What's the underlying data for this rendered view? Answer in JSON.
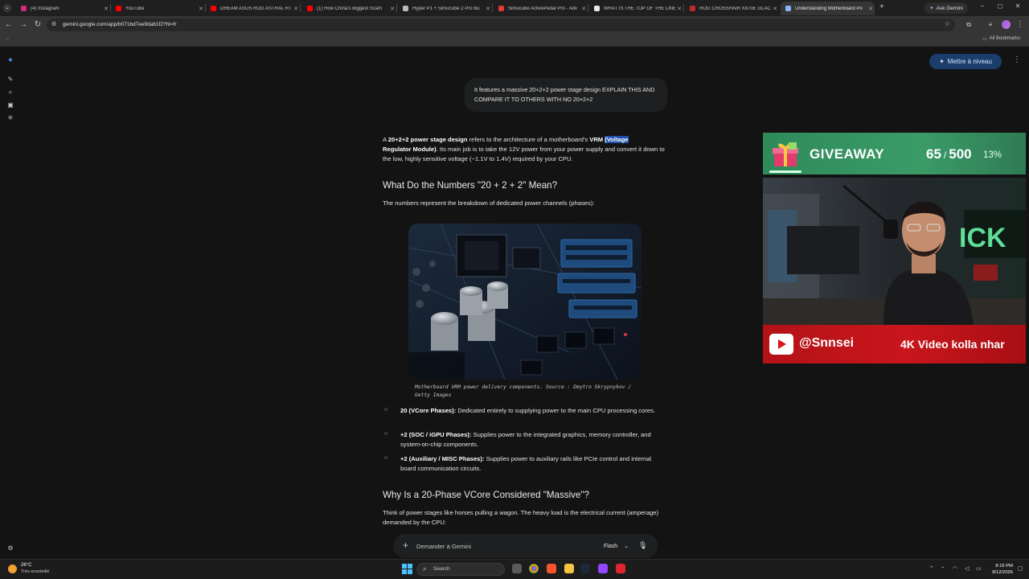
{
  "browser": {
    "tabs": [
      {
        "title": "(4) Instagram",
        "color": "#d62976"
      },
      {
        "title": "YouTube",
        "color": "#ff0000"
      },
      {
        "title": "DREAM ASUS ROG ASTRAL RTX",
        "color": "#ff0000"
      },
      {
        "title": "(1) How China's Biggest Scam",
        "color": "#ff0000"
      },
      {
        "title": "Hyper P1 + Simucube 2 Pro Bu",
        "color": "#bdbdbd"
      },
      {
        "title": "Simucube ActivePedal Pro - Adv",
        "color": "#e53935"
      },
      {
        "title": "WHAT IS THE TOP OF THE LINE",
        "color": "#e8eaed"
      },
      {
        "title": "ROG CROSSHAIR X870E GLACI",
        "color": "#c62828"
      },
      {
        "title": "Understanding Motherboard Po",
        "color": "#8ab4f8"
      }
    ],
    "ask_gemini": "Ask Gemini",
    "url": "gemini.google.com/app/b071bd7ee9dab1f2?hl=fr",
    "all_bookmarks": "All Bookmarks"
  },
  "gemini": {
    "upgrade_label": "Mettre à niveau",
    "user_prompt": "It features a massive 20+2+2 power stage design EXPLAIN THIS AND COMPARE IT TO OTHERS WITH NO 20+2+2",
    "intro": {
      "p1": "A ",
      "b1": "20+2+2 power stage design",
      "p2": " refers to the architecture of a motherboard's ",
      "b2": "VRM ",
      "hl": "(Voltage",
      "b3": "Regulator Module)",
      "p3": ". Its main job is to take the 12V power from your power supply and convert it down to the low, highly sensitive voltage (~1.1V to 1.4V) required by your CPU."
    },
    "heading1": "What Do the Numbers \"20 + 2 + 2\" Mean?",
    "numbers_intro": "The numbers represent the breakdown of dedicated power channels (phases):",
    "figure_caption": "Motherboard VRM power delivery components. Source : Dmytro Skrypnykov / Getty Images",
    "list": [
      {
        "bold": "20 (VCore Phases):",
        "text": " Dedicated entirely to supplying power to the main CPU processing cores."
      },
      {
        "bold": "+2 (SOC / iGPU Phases):",
        "text": " Supplies power to the integrated graphics, memory controller, and system-on-chip components."
      },
      {
        "bold": "+2 (Auxiliary / MISC Phases):",
        "text": " Supplies power to auxiliary rails like PCIe control and internal board communication circuits."
      }
    ],
    "heading2": "Why Is a 20-Phase VCore Considered \"Massive\"?",
    "analogy": "Think of power stages like horses pulling a wagon. The heavy load is the electrical current (amperage) demanded by the CPU:",
    "prompt_placeholder": "Demander à Gemini",
    "model_label": "Flash"
  },
  "overlay": {
    "giveaway_title": "GIVEAWAY",
    "count_current": "65",
    "count_total": "500",
    "percent": "13%",
    "progress_fraction": 0.13,
    "channel_handle": "@Snnsei",
    "channel_message": "4K Video kolla nhar"
  },
  "taskbar": {
    "temperature": "26°C",
    "weather_desc": "Très ensoleillé",
    "search_label": "Search",
    "time": "8:16 PM",
    "date": "8/12/2026"
  }
}
